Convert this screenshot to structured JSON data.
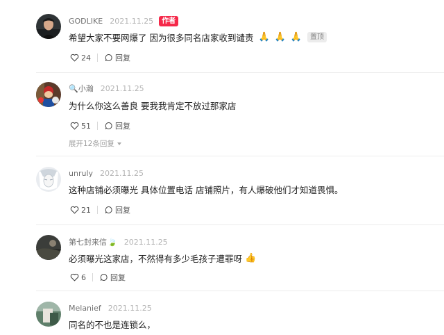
{
  "comments": [
    {
      "username": "GODLIKE",
      "date": "2021.11.25",
      "author_badge": "作者",
      "text": "希望大家不要网爆了 因为很多同名店家收到谴责",
      "emojis": [
        "🙏",
        "🙏",
        "🙏"
      ],
      "pinned_label": "置顶",
      "likes": "24",
      "reply_label": "回复"
    },
    {
      "username": "🔍小瀚",
      "date": "2021.11.25",
      "text": "为什么你这么善良 要我我肯定不放过那家店",
      "likes": "51",
      "reply_label": "回复",
      "expand_label": "展开12条回复"
    },
    {
      "username": "unruly",
      "date": "2021.11.25",
      "text": "这种店铺必须曝光 具体位置电话 店铺照片，有人爆破他们才知道畏惧。",
      "likes": "21",
      "reply_label": "回复"
    },
    {
      "username": "第七封来信",
      "username_emoji": "🍃",
      "date": "2021.11.25",
      "text": "必须曝光这家店，不然得有多少毛孩子遭罪呀",
      "emoji": "👍",
      "likes": "6",
      "reply_label": "回复"
    },
    {
      "username": "Melanief",
      "date": "2021.11.25",
      "text": "同名的不也是连锁么，"
    }
  ]
}
